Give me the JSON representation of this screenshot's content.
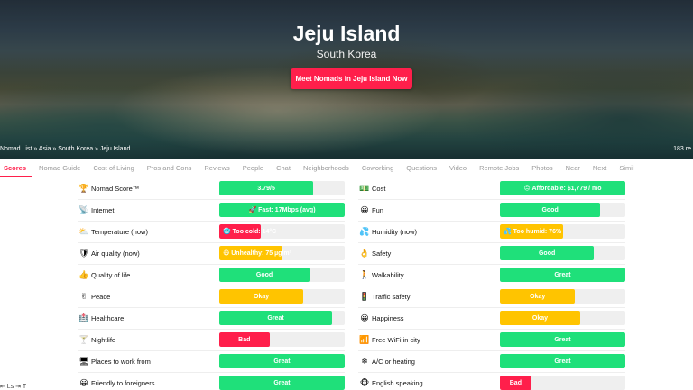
{
  "hero": {
    "title": "Jeju Island",
    "subtitle": "South Korea",
    "cta": "Meet Nomads in Jeju Island Now",
    "breadcrumb": "Nomad List » Asia » South Korea » Jeju Island",
    "count": "183 re"
  },
  "tabs": [
    "Scores",
    "Nomad Guide",
    "Cost of Living",
    "Pros and Cons",
    "Reviews",
    "People",
    "Chat",
    "Neighborhoods",
    "Coworking",
    "Questions",
    "Video",
    "Remote Jobs",
    "Photos",
    "Near",
    "Next",
    "Simil"
  ],
  "colors": {
    "green": "#1fe07a",
    "yellow": "#ffc400",
    "red": "#ff1f4b",
    "accent": "#ff1f4b",
    "track": "#efefef"
  },
  "left": [
    {
      "icon": "🏆",
      "label": "Nomad Score™",
      "value": "3.79/5",
      "level": 0.75,
      "color": "green"
    },
    {
      "icon": "📡",
      "label": "Internet",
      "value": "🚀 Fast: 17Mbps (avg)",
      "level": 1.0,
      "color": "green"
    },
    {
      "icon": "⛅",
      "label": "Temperature (now)",
      "value": "🥶 Too cold: 14°C",
      "level": 0.33,
      "color": "red",
      "align": "left"
    },
    {
      "icon": "🛡",
      "label": "Air quality (now)",
      "value": "😷 Unhealthy: 75 µg/m³",
      "level": 0.5,
      "color": "yellow",
      "align": "left"
    },
    {
      "icon": "👍",
      "label": "Quality of life",
      "value": "Good",
      "level": 0.72,
      "color": "green"
    },
    {
      "icon": "✌",
      "label": "Peace",
      "value": "Okay",
      "level": 0.67,
      "color": "yellow"
    },
    {
      "icon": "🏥",
      "label": "Healthcare",
      "value": "Great",
      "level": 0.9,
      "color": "green"
    },
    {
      "icon": "🍸",
      "label": "Nightlife",
      "value": "Bad",
      "level": 0.4,
      "color": "red"
    },
    {
      "icon": "🖥",
      "label": "Places to work from",
      "value": "Great",
      "level": 1.0,
      "color": "green"
    },
    {
      "icon": "😀",
      "label": "Friendly to foreigners",
      "value": "Great",
      "level": 1.0,
      "color": "green"
    }
  ],
  "right": [
    {
      "icon": "💵",
      "label": "Cost",
      "value": "😐 Affordable: $1,779 / mo",
      "level": 1.0,
      "color": "green"
    },
    {
      "icon": "😀",
      "label": "Fun",
      "value": "Good",
      "level": 0.8,
      "color": "green"
    },
    {
      "icon": "💦",
      "label": "Humidity (now)",
      "value": "💦 Too humid: 76%",
      "level": 0.5,
      "color": "yellow",
      "align": "left"
    },
    {
      "icon": "👌",
      "label": "Safety",
      "value": "Good",
      "level": 0.75,
      "color": "green"
    },
    {
      "icon": "🚶",
      "label": "Walkability",
      "value": "Great",
      "level": 1.0,
      "color": "green"
    },
    {
      "icon": "🚦",
      "label": "Traffic safety",
      "value": "Okay",
      "level": 0.6,
      "color": "yellow"
    },
    {
      "icon": "😀",
      "label": "Happiness",
      "value": "Okay",
      "level": 0.64,
      "color": "yellow"
    },
    {
      "icon": "📶",
      "label": "Free WiFi in city",
      "value": "Great",
      "level": 1.0,
      "color": "green"
    },
    {
      "icon": "❄",
      "label": "A/C or heating",
      "value": "Great",
      "level": 1.0,
      "color": "green"
    },
    {
      "icon": "🐵",
      "label": "English speaking",
      "value": "Bad",
      "level": 0.25,
      "color": "red"
    }
  ],
  "corner": "⇤ Ls ⇥ T"
}
